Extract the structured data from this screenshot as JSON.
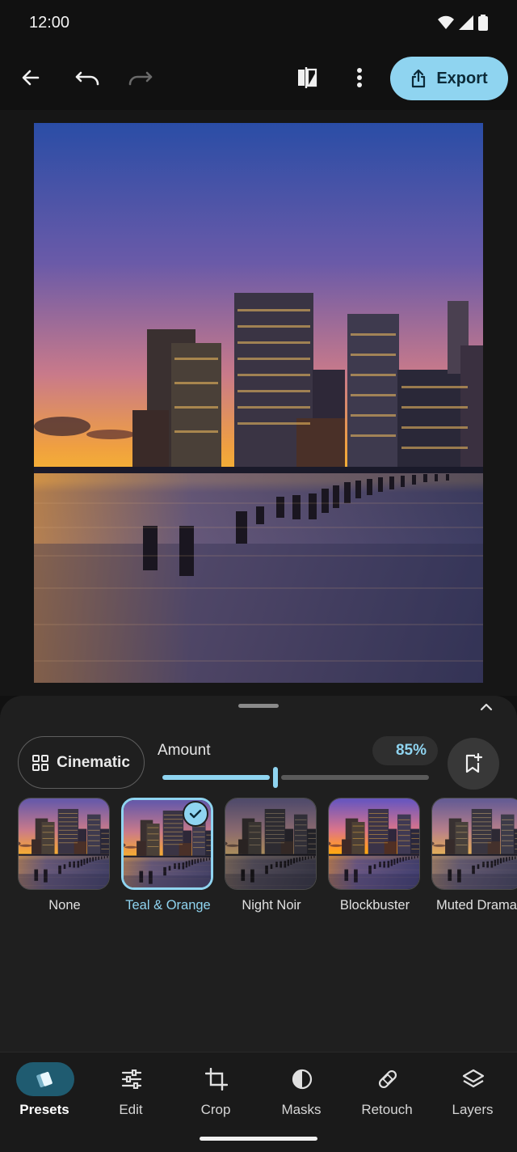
{
  "status_bar": {
    "time": "12:00"
  },
  "toolbar": {
    "export_label": "Export"
  },
  "panel": {
    "category_label": "Cinematic",
    "amount_label": "Amount",
    "amount_value": "85%",
    "amount_fraction": 0.42
  },
  "presets": [
    {
      "label": "None",
      "selected": false
    },
    {
      "label": "Teal & Orange",
      "selected": true
    },
    {
      "label": "Night Noir",
      "selected": false
    },
    {
      "label": "Blockbuster",
      "selected": false
    },
    {
      "label": "Muted Drama",
      "selected": false
    }
  ],
  "nav": [
    {
      "label": "Presets",
      "icon": "presets-icon",
      "active": true
    },
    {
      "label": "Edit",
      "icon": "sliders-icon",
      "active": false
    },
    {
      "label": "Crop",
      "icon": "crop-icon",
      "active": false
    },
    {
      "label": "Masks",
      "icon": "masks-icon",
      "active": false
    },
    {
      "label": "Retouch",
      "icon": "bandage-icon",
      "active": false
    },
    {
      "label": "Layers",
      "icon": "layers-icon",
      "active": false
    }
  ],
  "colors": {
    "accent": "#8fd4f0",
    "background": "#111111",
    "sheet": "#1f1f1f"
  }
}
